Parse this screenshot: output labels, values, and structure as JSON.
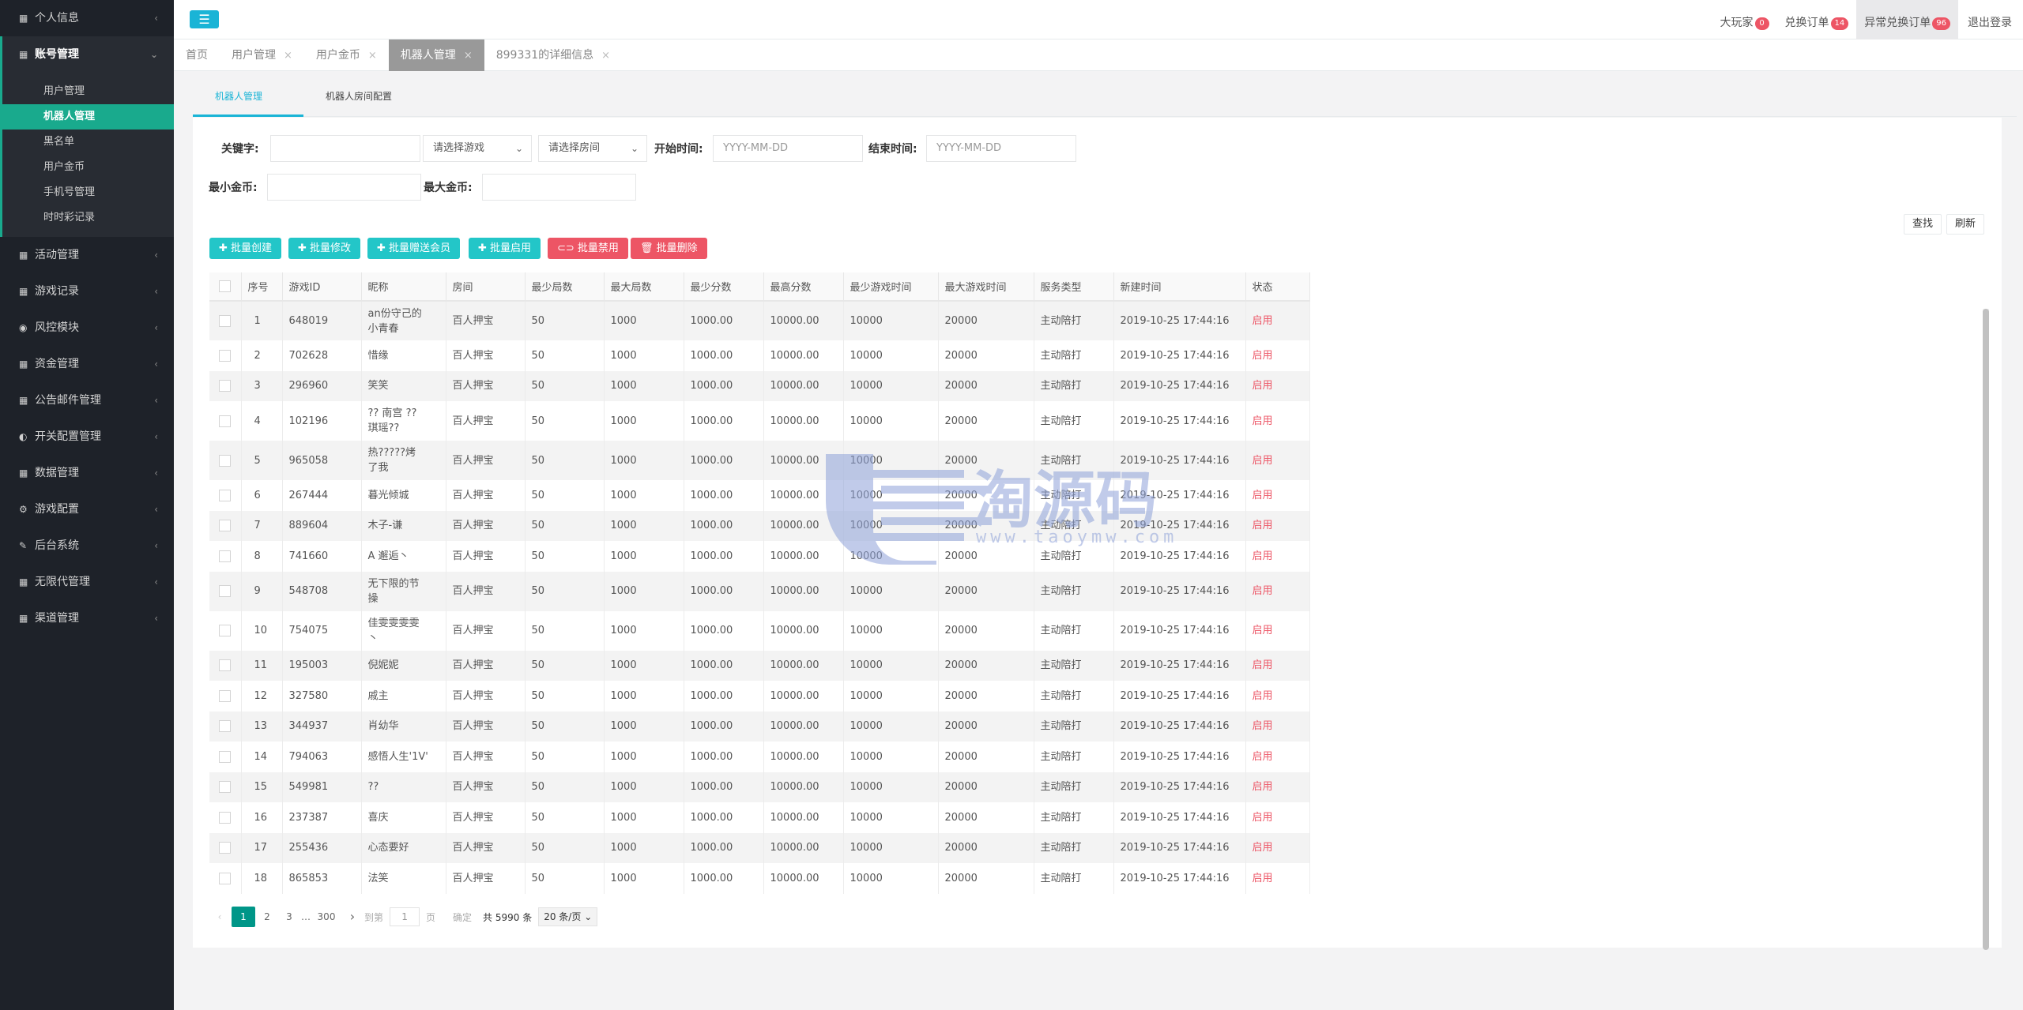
{
  "sidebar": {
    "items": [
      {
        "label": "个人信息",
        "icon": "grid-icon",
        "arrow": "‹"
      },
      {
        "label": "账号管理",
        "icon": "grid-icon",
        "arrow": "⌄"
      },
      {
        "label": "活动管理",
        "icon": "grid-icon",
        "arrow": "‹"
      },
      {
        "label": "游戏记录",
        "icon": "grid-icon",
        "arrow": "‹"
      },
      {
        "label": "风控模块",
        "icon": "eye-icon",
        "arrow": "‹"
      },
      {
        "label": "资金管理",
        "icon": "grid-icon",
        "arrow": "‹"
      },
      {
        "label": "公告邮件管理",
        "icon": "grid-icon",
        "arrow": "‹"
      },
      {
        "label": "开关配置管理",
        "icon": "toggle-icon",
        "arrow": "‹"
      },
      {
        "label": "数据管理",
        "icon": "grid-icon",
        "arrow": "‹"
      },
      {
        "label": "游戏配置",
        "icon": "gears-icon",
        "arrow": "‹"
      },
      {
        "label": "后台系统",
        "icon": "wrench-icon",
        "arrow": "‹"
      },
      {
        "label": "无限代管理",
        "icon": "grid-icon",
        "arrow": "‹"
      },
      {
        "label": "渠道管理",
        "icon": "grid-icon",
        "arrow": "‹"
      }
    ],
    "submenu": [
      "用户管理",
      "机器人管理",
      "黑名单",
      "用户金币",
      "手机号管理",
      "时时彩记录"
    ]
  },
  "topbar": {
    "menu_icon": "☰",
    "links": [
      {
        "label": "大玩家",
        "badge": "0"
      },
      {
        "label": "兑换订单",
        "badge": "14"
      },
      {
        "label": "异常兑换订单",
        "badge": "96"
      },
      {
        "label": "退出登录"
      }
    ]
  },
  "page_tabs": [
    {
      "label": "首页"
    },
    {
      "label": "用户管理",
      "close": "×"
    },
    {
      "label": "用户金币",
      "close": "×"
    },
    {
      "label": "机器人管理",
      "close": "×"
    },
    {
      "label": "899331的详细信息",
      "close": "×"
    }
  ],
  "sub_tabs": [
    "机器人管理",
    "机器人房间配置"
  ],
  "filters": {
    "keyword_label": "关键字:",
    "game_select": "请选择游戏",
    "room_select": "请选择房间",
    "start_label": "开始时间:",
    "start_placeholder": "YYYY-MM-DD",
    "end_label": "结束时间:",
    "end_placeholder": "YYYY-MM-DD",
    "min_gold_label": "最小金币:",
    "max_gold_label": "最大金币:",
    "search_btn": "查找",
    "refresh_btn": "刷新"
  },
  "actions": [
    {
      "label": "✚ 批量创建",
      "color": "#23c6c8"
    },
    {
      "label": "✚ 批量修改",
      "color": "#23c6c8"
    },
    {
      "label": "✚ 批量赠送会员",
      "color": "#23c6c8"
    },
    {
      "label": "✚ 批量启用",
      "color": "#23c6c8"
    },
    {
      "label": "⊂⊃ 批量禁用",
      "color": "#ed5565"
    },
    {
      "label": "🗑 批量删除",
      "color": "#ed5565"
    }
  ],
  "table": {
    "headers": [
      "",
      "序号",
      "游戏ID",
      "昵称",
      "房间",
      "最少局数",
      "最大局数",
      "最少分数",
      "最高分数",
      "最少游戏时间",
      "最大游戏时间",
      "服务类型",
      "新建时间",
      "状态"
    ],
    "rows": [
      [
        "1",
        "648019",
        "an份守己的\n小青春",
        "百人押宝",
        "50",
        "1000",
        "1000.00",
        "10000.00",
        "10000",
        "20000",
        "主动陪打",
        "2019-10-25 17:44:16",
        "启用"
      ],
      [
        "2",
        "702628",
        "惜缘",
        "百人押宝",
        "50",
        "1000",
        "1000.00",
        "10000.00",
        "10000",
        "20000",
        "主动陪打",
        "2019-10-25 17:44:16",
        "启用"
      ],
      [
        "3",
        "296960",
        "笑笑",
        "百人押宝",
        "50",
        "1000",
        "1000.00",
        "10000.00",
        "10000",
        "20000",
        "主动陪打",
        "2019-10-25 17:44:16",
        "启用"
      ],
      [
        "4",
        "102196",
        "?? 南宫 ??\n琪瑶??",
        "百人押宝",
        "50",
        "1000",
        "1000.00",
        "10000.00",
        "10000",
        "20000",
        "主动陪打",
        "2019-10-25 17:44:16",
        "启用"
      ],
      [
        "5",
        "965058",
        "热?????烤\n了我",
        "百人押宝",
        "50",
        "1000",
        "1000.00",
        "10000.00",
        "10000",
        "20000",
        "主动陪打",
        "2019-10-25 17:44:16",
        "启用"
      ],
      [
        "6",
        "267444",
        "暮光倾城",
        "百人押宝",
        "50",
        "1000",
        "1000.00",
        "10000.00",
        "10000",
        "20000",
        "主动陪打",
        "2019-10-25 17:44:16",
        "启用"
      ],
      [
        "7",
        "889604",
        "木子-谦",
        "百人押宝",
        "50",
        "1000",
        "1000.00",
        "10000.00",
        "10000",
        "20000",
        "主动陪打",
        "2019-10-25 17:44:16",
        "启用"
      ],
      [
        "8",
        "741660",
        "A 邂逅丶",
        "百人押宝",
        "50",
        "1000",
        "1000.00",
        "10000.00",
        "10000",
        "20000",
        "主动陪打",
        "2019-10-25 17:44:16",
        "启用"
      ],
      [
        "9",
        "548708",
        "无下限的节\n操",
        "百人押宝",
        "50",
        "1000",
        "1000.00",
        "10000.00",
        "10000",
        "20000",
        "主动陪打",
        "2019-10-25 17:44:16",
        "启用"
      ],
      [
        "10",
        "754075",
        "佳雯雯雯雯\n丶",
        "百人押宝",
        "50",
        "1000",
        "1000.00",
        "10000.00",
        "10000",
        "20000",
        "主动陪打",
        "2019-10-25 17:44:16",
        "启用"
      ],
      [
        "11",
        "195003",
        "倪妮妮",
        "百人押宝",
        "50",
        "1000",
        "1000.00",
        "10000.00",
        "10000",
        "20000",
        "主动陪打",
        "2019-10-25 17:44:16",
        "启用"
      ],
      [
        "12",
        "327580",
        "戚主",
        "百人押宝",
        "50",
        "1000",
        "1000.00",
        "10000.00",
        "10000",
        "20000",
        "主动陪打",
        "2019-10-25 17:44:16",
        "启用"
      ],
      [
        "13",
        "344937",
        "肖幼华",
        "百人押宝",
        "50",
        "1000",
        "1000.00",
        "10000.00",
        "10000",
        "20000",
        "主动陪打",
        "2019-10-25 17:44:16",
        "启用"
      ],
      [
        "14",
        "794063",
        "感悟人生'1V'",
        "百人押宝",
        "50",
        "1000",
        "1000.00",
        "10000.00",
        "10000",
        "20000",
        "主动陪打",
        "2019-10-25 17:44:16",
        "启用"
      ],
      [
        "15",
        "549981",
        "??",
        "百人押宝",
        "50",
        "1000",
        "1000.00",
        "10000.00",
        "10000",
        "20000",
        "主动陪打",
        "2019-10-25 17:44:16",
        "启用"
      ],
      [
        "16",
        "237387",
        "喜庆",
        "百人押宝",
        "50",
        "1000",
        "1000.00",
        "10000.00",
        "10000",
        "20000",
        "主动陪打",
        "2019-10-25 17:44:16",
        "启用"
      ],
      [
        "17",
        "255436",
        "心态要好",
        "百人押宝",
        "50",
        "1000",
        "1000.00",
        "10000.00",
        "10000",
        "20000",
        "主动陪打",
        "2019-10-25 17:44:16",
        "启用"
      ],
      [
        "18",
        "865853",
        "法笑",
        "百人押宝",
        "50",
        "1000",
        "1000.00",
        "10000.00",
        "10000",
        "20000",
        "主动陪打",
        "2019-10-25 17:44:16",
        "启用"
      ]
    ]
  },
  "pagination": {
    "prev": "‹",
    "pages": [
      "1",
      "2",
      "3",
      "…",
      "300"
    ],
    "next": "›",
    "goto_label": "到第",
    "goto_value": "1",
    "page_unit": "页",
    "confirm": "确定",
    "total": "共 5990 条",
    "page_size": "20 条/页"
  },
  "watermark": {
    "text": "淘源码",
    "url": "www.taoymw.com"
  }
}
